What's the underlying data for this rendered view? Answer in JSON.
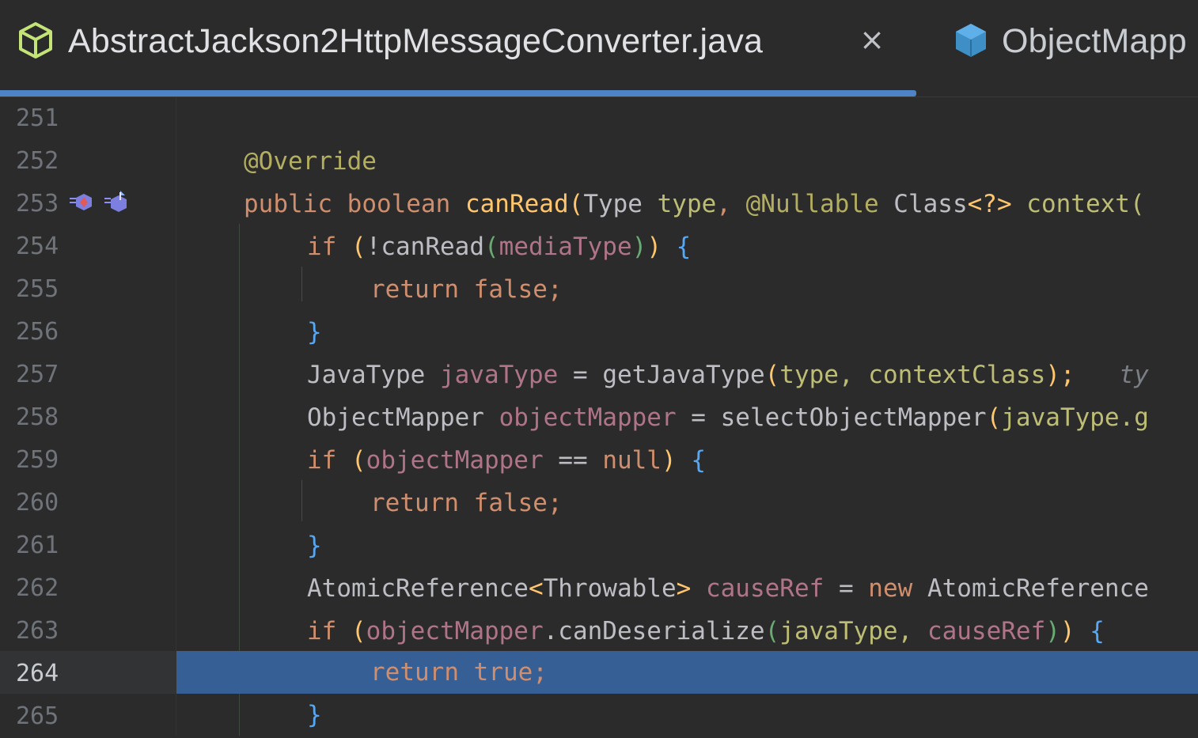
{
  "tabs": [
    {
      "label": "AbstractJackson2HttpMessageConverter.java",
      "active": true,
      "close_glyph": "×"
    },
    {
      "label": "ObjectMapp",
      "active": false
    }
  ],
  "gutter": {
    "line_numbers": [
      "251",
      "252",
      "253",
      "254",
      "255",
      "256",
      "257",
      "258",
      "259",
      "260",
      "261",
      "262",
      "263",
      "264",
      "265"
    ],
    "current_line": "264"
  },
  "code": {
    "l252": "@Override",
    "l253": {
      "t1": "public",
      "t2": "boolean",
      "t3": "canRead",
      "t4": "(",
      "t5": "Type",
      "t6": "type",
      "t7": ",",
      "t8": "@Nullable",
      "t9": "Class",
      "t10": "<?>",
      "t11": "context("
    },
    "l254": {
      "t1": "if",
      "t2": "(",
      "t3": "!canRead",
      "t4": "(",
      "t5": "mediaType",
      "t6": ")",
      "t7": ")",
      "t8": "{"
    },
    "l255": {
      "t1": "return",
      "t2": "false;"
    },
    "l256": "}",
    "l257": {
      "t1": "JavaType",
      "t2": "javaType",
      "t3": "=",
      "t4": "getJavaType",
      "t5": "(",
      "t6": "type,",
      "t7": "contextClass",
      "t8": ");",
      "t9": "ty"
    },
    "l258": {
      "t1": "ObjectMapper",
      "t2": "objectMapper",
      "t3": "=",
      "t4": "selectObjectMapper",
      "t5": "(",
      "t6": "javaType.g"
    },
    "l259": {
      "t1": "if",
      "t2": "(",
      "t3": "objectMapper",
      "t4": "==",
      "t5": "null",
      "t6": ")",
      "t7": "{"
    },
    "l260": {
      "t1": "return",
      "t2": "false;"
    },
    "l261": "}",
    "l262": {
      "t1": "AtomicReference",
      "t2": "<",
      "t3": "Throwable",
      "t4": ">",
      "t5": "causeRef",
      "t6": "=",
      "t7": "new",
      "t8": "AtomicReference"
    },
    "l263": {
      "t1": "if",
      "t2": "(",
      "t3": "objectMapper",
      "t4": ".canDeserialize",
      "t5": "(",
      "t6": "javaType,",
      "t7": "causeRef",
      "t8": ")",
      "t9": ")",
      "t10": "{"
    },
    "l264": {
      "t1": "return",
      "t2": "true;"
    },
    "l265": "}"
  },
  "colors": {
    "accent": "#4e84c6",
    "selection": "#365f95",
    "keyword": "#cf8e6d",
    "annotation": "#b3ae60",
    "method": "#ffc66d"
  },
  "icons": {
    "active_tab": "java-class-outline-icon",
    "inactive_tab": "java-class-filled-icon",
    "gutter": [
      "implemented-method-icon",
      "overridden-method-icon"
    ]
  }
}
